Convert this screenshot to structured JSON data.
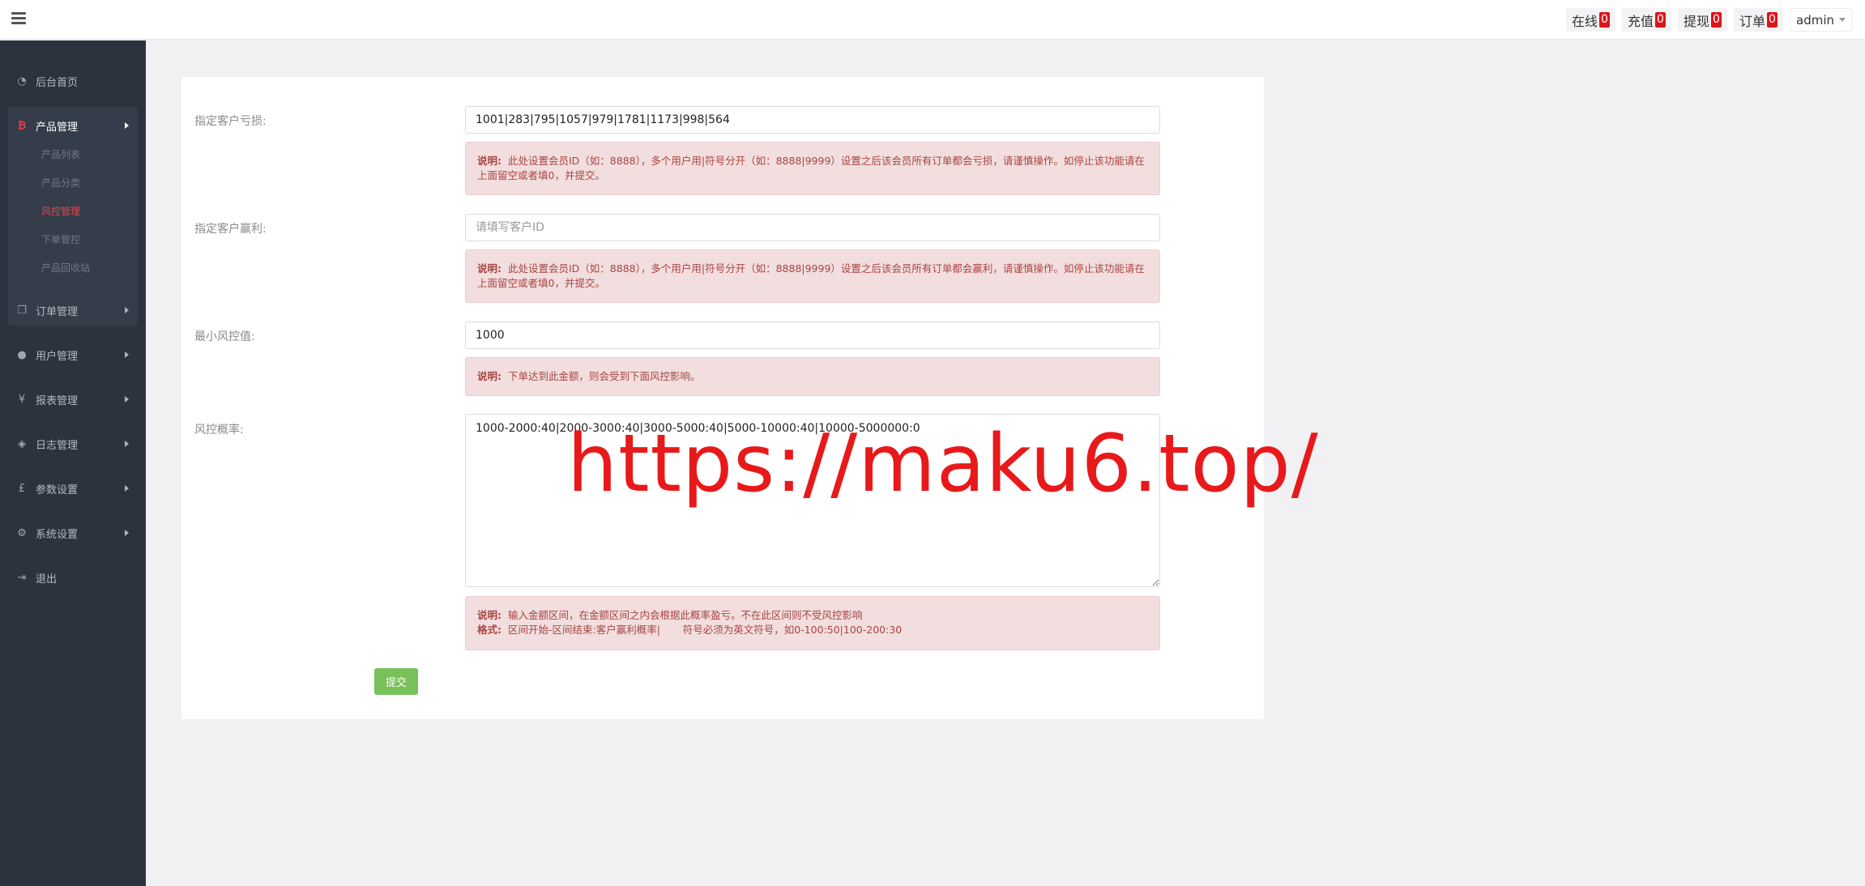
{
  "topbar": {
    "items": [
      {
        "label": "在线",
        "count": "0"
      },
      {
        "label": "充值",
        "count": "0"
      },
      {
        "label": "提现",
        "count": "0"
      },
      {
        "label": "订单",
        "count": "0"
      }
    ],
    "user": "admin"
  },
  "sidebar": {
    "home": {
      "label": "后台首页",
      "icon": "dashboard-icon"
    },
    "product": {
      "label": "产品管理",
      "icon": "bitcoin-icon"
    },
    "sub": [
      "产品列表",
      "产品分类",
      "风控管理",
      "下单管控",
      "产品回收站"
    ],
    "items": [
      {
        "label": "订单管理",
        "icon": "copy-icon"
      },
      {
        "label": "用户管理",
        "icon": "user-icon"
      },
      {
        "label": "报表管理",
        "icon": "yen-icon"
      },
      {
        "label": "日志管理",
        "icon": "tag-icon"
      },
      {
        "label": "参数设置",
        "icon": "pound-icon"
      },
      {
        "label": "系统设置",
        "icon": "gears-icon"
      },
      {
        "label": "退出",
        "icon": "sign-out-icon"
      }
    ],
    "accent": "#e6434f"
  },
  "form": {
    "loss": {
      "label": "指定客户亏损:",
      "value": "1001|283|795|1057|979|1781|1173|998|564",
      "note_title": "说明:",
      "note": "此处设置会员ID（如：8888），多个用户用|符号分开（如：8888|9999）设置之后该会员所有订单都会亏损，请谨慎操作。如停止该功能请在上面留空或者填0，并提交。"
    },
    "profit": {
      "label": "指定客户赢利:",
      "placeholder": "请填写客户ID",
      "note_title": "说明:",
      "note": "此处设置会员ID（如：8888），多个用户用|符号分开（如：8888|9999）设置之后该会员所有订单都会赢利，请谨慎操作。如停止该功能请在上面留空或者填0，并提交。"
    },
    "min": {
      "label": "最小风控值:",
      "value": "1000",
      "note_title": "说明:",
      "note": "下单达到此金额，则会受到下面风控影响。"
    },
    "prob": {
      "label": "风控概率:",
      "value": "1000-2000:40|2000-3000:40|3000-5000:40|5000-10000:40|10000-5000000:0",
      "note_title": "说明:",
      "note": "输入金额区间，在金额区间之内会根据此概率盈亏。不在此区间则不受风控影响",
      "format_title": "格式:",
      "format": "区间开始-区间结束:客户赢利概率|       符号必须为英文符号，如0-100:50|100-200:30"
    },
    "submit": "提交"
  },
  "watermark": "https://maku6.top/"
}
